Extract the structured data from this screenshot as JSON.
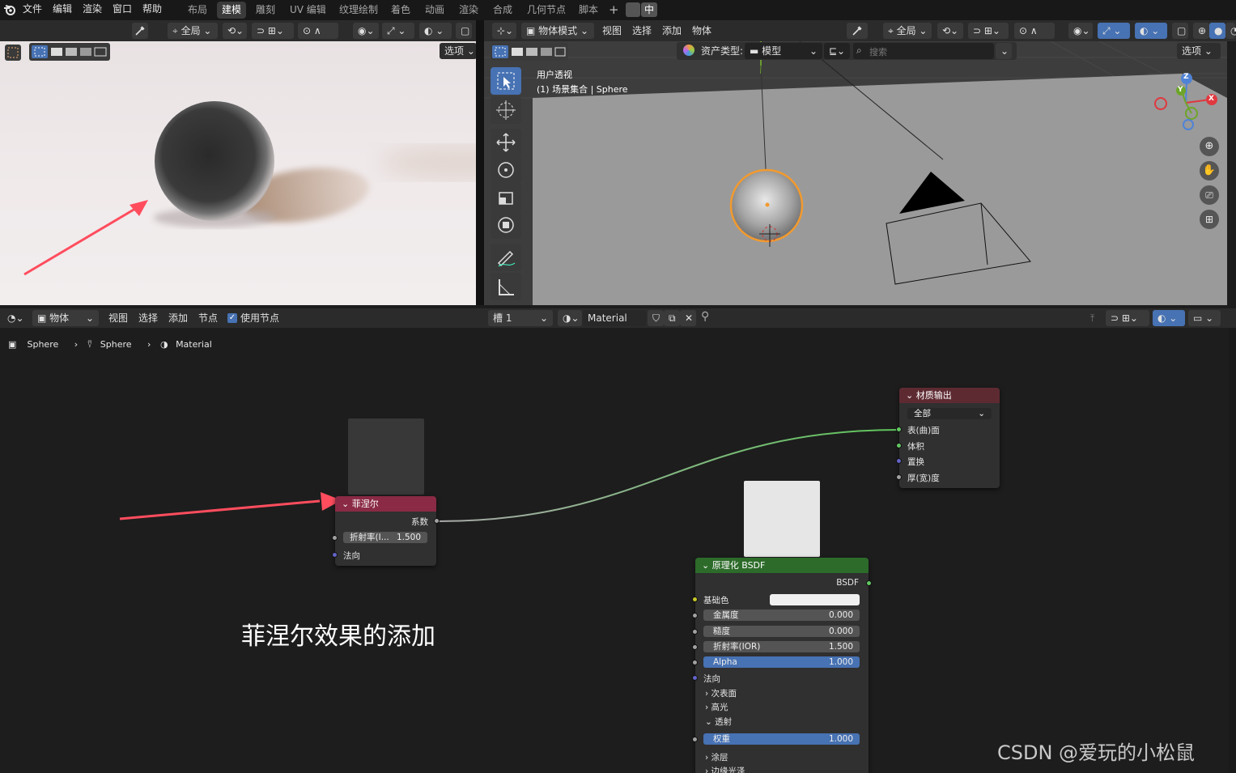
{
  "top_menu": [
    "文件",
    "编辑",
    "渲染",
    "窗口",
    "帮助"
  ],
  "workspaces": [
    "布局",
    "建模",
    "雕刻",
    "UV 编辑",
    "纹理绘制",
    "着色",
    "动画",
    "渲染",
    "合成",
    "几何节点",
    "脚本"
  ],
  "active_workspace": "建模",
  "ime": "中",
  "left_view": {
    "global_label": "全局",
    "options_label": "选项"
  },
  "right_view": {
    "mode_label": "物体模式",
    "menus": [
      "视图",
      "选择",
      "添加",
      "物体"
    ],
    "global_label": "全局",
    "asset_type_label": "资产类型:",
    "asset_type_value": "模型",
    "search_placeholder": "搜索",
    "options_label": "选项",
    "view_title": "用户透视",
    "view_subtitle": "(1) 场景集合 | Sphere",
    "gizmo": {
      "z": "Z",
      "y": "Y",
      "x": "X"
    }
  },
  "node_editor": {
    "object_dropdown": "物体",
    "menus": [
      "视图",
      "选择",
      "添加",
      "节点"
    ],
    "use_nodes_label": "使用节点",
    "slot_label": "槽 1",
    "material_name": "Material",
    "breadcrumb": [
      "Sphere",
      "Sphere",
      "Material"
    ],
    "annotation_caption": "菲涅尔效果的添加",
    "watermark": "CSDN @爱玩的小松鼠",
    "fresnel": {
      "title": "菲涅尔",
      "output_label": "系数",
      "ior_label": "折射率(I...",
      "ior_value": "1.500",
      "normal_label": "法向"
    },
    "material_output": {
      "title": "材质输出",
      "target": "全部",
      "inputs": [
        "表(曲)面",
        "体积",
        "置换",
        "厚(宽)度"
      ]
    },
    "bsdf": {
      "title": "原理化 BSDF",
      "output_label": "BSDF",
      "base_color_label": "基础色",
      "fields": [
        {
          "label": "金属度",
          "value": "0.000",
          "highlight": false
        },
        {
          "label": "糙度",
          "value": "0.000",
          "highlight": false
        },
        {
          "label": "折射率(IOR)",
          "value": "1.500",
          "highlight": false
        },
        {
          "label": "Alpha",
          "value": "1.000",
          "highlight": true
        }
      ],
      "normal_label": "法向",
      "sections": [
        "次表面",
        "高光"
      ],
      "transmission_label": "透射",
      "weight_label": "权重",
      "weight_value": "1.000",
      "sections_after": [
        "涂层",
        "边缘光泽"
      ]
    }
  },
  "colors": {
    "fresnel_header": "#8a2a45",
    "output_header": "#5e2a32",
    "bsdf_header": "#2d6b2a",
    "accent_blue": "#4772b3",
    "annotation_arrow": "#ff4d5e",
    "selection_orange": "#f29a2e"
  }
}
